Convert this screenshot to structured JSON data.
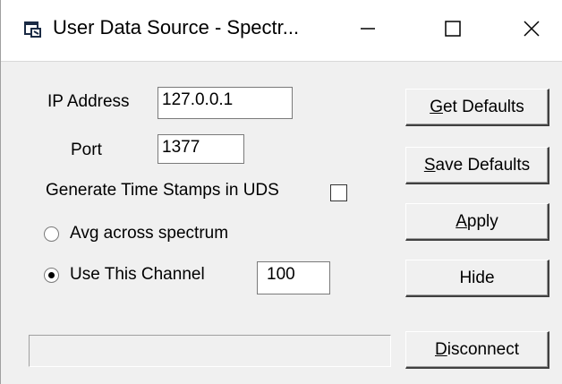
{
  "window": {
    "title": "User Data Source - Spectr..."
  },
  "form": {
    "ip_label": "IP Address",
    "ip_value": "127.0.0.1",
    "port_label": "Port",
    "port_value": "1377",
    "timestamps_label": "Generate Time Stamps in UDS",
    "timestamps_checked": false,
    "avg_label": "Avg across spectrum",
    "avg_selected": false,
    "channel_label": "Use This Channel",
    "channel_selected": true,
    "channel_value": "100"
  },
  "buttons": {
    "get_defaults": {
      "accel": "G",
      "rest": "et Defaults"
    },
    "save_defaults": {
      "accel": "S",
      "rest": "ave Defaults"
    },
    "apply": {
      "accel": "A",
      "rest": "pply"
    },
    "hide": {
      "label": "Hide"
    },
    "disconnect": {
      "accel": "D",
      "rest": "isconnect"
    }
  },
  "status": {
    "text": ""
  },
  "icons": {
    "app": "app-window-icon",
    "minimize": "minimize-icon",
    "maximize": "maximize-icon",
    "close": "close-icon"
  }
}
